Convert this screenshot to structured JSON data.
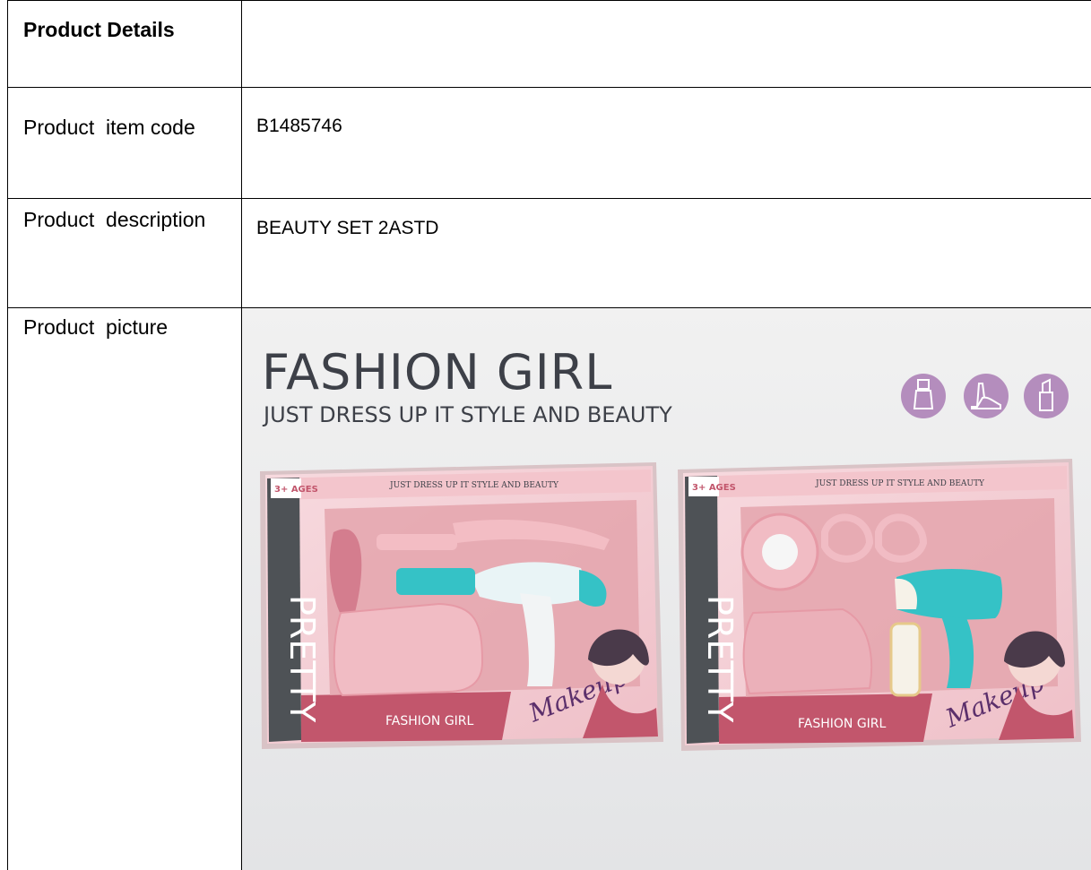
{
  "table": {
    "header": "Product Details",
    "rows": [
      {
        "label": "Product  item code",
        "value": "B1485746"
      },
      {
        "label": "Product  description",
        "value": "BEAUTY SET 2ASTD"
      },
      {
        "label": "Product  picture",
        "value": ""
      }
    ]
  },
  "picture": {
    "headline": "FASHION GIRL",
    "tagline": "JUST DRESS UP IT STYLE AND BEAUTY",
    "icons": [
      "nail-polish-icon",
      "high-heel-icon",
      "lipstick-icon"
    ],
    "box_left": {
      "age": "3+ AGES",
      "top_text": "JUST DRESS UP IT STYLE AND BEAUTY",
      "side_text": "PRETTY",
      "bottom_text": "FASHION GIRL",
      "script": "Makeup"
    },
    "box_right": {
      "age": "3+ AGES",
      "top_text": "JUST DRESS UP IT STYLE AND BEAUTY",
      "side_text": "PRETTY",
      "bottom_text": "FASHION GIRL",
      "script": "Makeup"
    },
    "colors": {
      "background": "#ebecec",
      "headline": "#3d4048",
      "icon_circle": "#b48dbd",
      "box_pink": "#f4c9cf",
      "box_band": "#c2566c",
      "side_band": "#4e5256",
      "teal": "#35c2c6"
    }
  }
}
